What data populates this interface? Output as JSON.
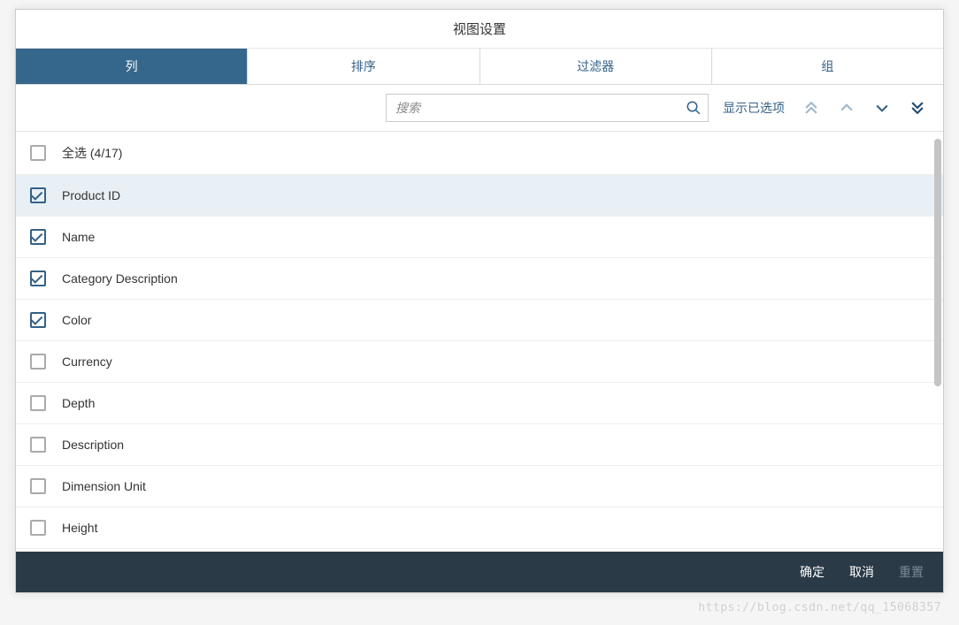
{
  "dialog": {
    "title": "视图设置"
  },
  "tabs": [
    {
      "label": "列",
      "active": true
    },
    {
      "label": "排序",
      "active": false
    },
    {
      "label": "过滤器",
      "active": false
    },
    {
      "label": "组",
      "active": false
    }
  ],
  "toolbar": {
    "search_placeholder": "搜索",
    "show_selected_label": "显示已选项"
  },
  "select_all": {
    "label": "全选 (4/17)",
    "checked": false
  },
  "columns": [
    {
      "label": "Product ID",
      "checked": true,
      "highlight": true
    },
    {
      "label": "Name",
      "checked": true,
      "highlight": false
    },
    {
      "label": "Category Description",
      "checked": true,
      "highlight": false
    },
    {
      "label": "Color",
      "checked": true,
      "highlight": false
    },
    {
      "label": "Currency",
      "checked": false,
      "highlight": false
    },
    {
      "label": "Depth",
      "checked": false,
      "highlight": false
    },
    {
      "label": "Description",
      "checked": false,
      "highlight": false
    },
    {
      "label": "Dimension Unit",
      "checked": false,
      "highlight": false
    },
    {
      "label": "Height",
      "checked": false,
      "highlight": false
    }
  ],
  "footer": {
    "ok": "确定",
    "cancel": "取消",
    "reset": "重置"
  },
  "colors": {
    "primary": "#346187",
    "footer_bg": "#2b3a47"
  },
  "watermark": "https://blog.csdn.net/qq_15068357"
}
